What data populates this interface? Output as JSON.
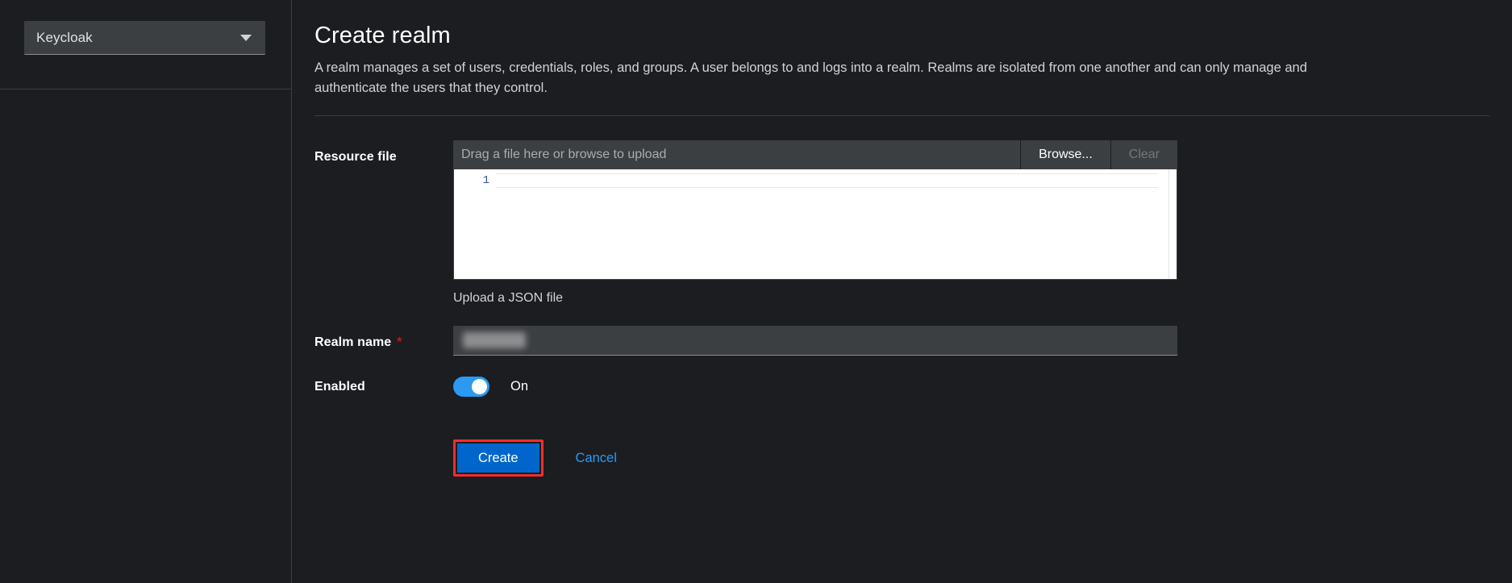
{
  "sidebar": {
    "realm_selector": {
      "label": "Keycloak",
      "icon": "chevron-down-icon"
    }
  },
  "main": {
    "title": "Create realm",
    "description": "A realm manages a set of users, credentials, roles, and groups. A user belongs to and logs into a realm. Realms are isolated from one another and can only manage and authenticate the users that they control."
  },
  "form": {
    "resource_file": {
      "label": "Resource file",
      "placeholder": "Drag a file here or browse to upload",
      "value": "",
      "browse_label": "Browse...",
      "clear_label": "Clear",
      "editor": {
        "line_numbers": "1",
        "content": ""
      },
      "helper_text": "Upload a JSON file"
    },
    "realm_name": {
      "label": "Realm name",
      "required_marker": "*",
      "value": "",
      "placeholder": ""
    },
    "enabled": {
      "label": "Enabled",
      "state_label": "On",
      "checked": true,
      "accent_color": "#2b9af3"
    },
    "actions": {
      "create_label": "Create",
      "cancel_label": "Cancel",
      "create_color": "#0066cc",
      "highlight_color": "#f92c2c"
    }
  }
}
